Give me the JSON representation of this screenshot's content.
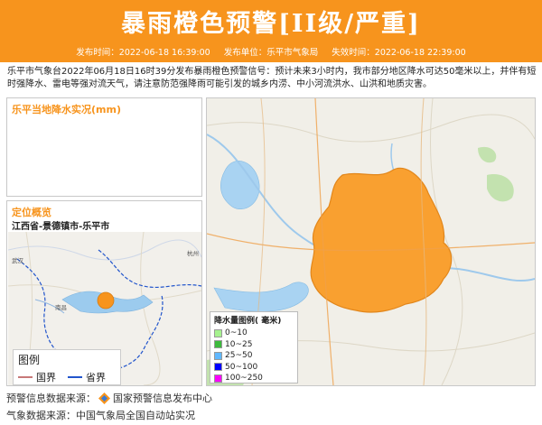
{
  "header": {
    "title": "暴雨橙色预警[II级/严重]",
    "publish_time": "发布时间：2022-06-18 16:39:00",
    "publisher": "发布单位：乐平市气象局",
    "expire_time": "失效时间：2022-06-18 22:39:00",
    "accent": "#f7941d"
  },
  "description": "乐平市气象台2022年06月18日16时39分发布暴雨橙色预警信号：预计未来3小时内，我市部分地区降水可达50毫米以上，并伴有短时强降水、雷电等强对流天气，请注意防范强降雨可能引发的城乡内涝、中小河流洪水、山洪和地质灾害。",
  "rain_panel": {
    "title": "乐平当地降水实况(mm)"
  },
  "location_panel": {
    "title": "定位概览",
    "location": "江西省-景德镇市-乐平市"
  },
  "location_map_labels": {
    "wuhan": "武汉",
    "nanchang": "南昌",
    "hangzhou": "杭州"
  },
  "rain_legend": {
    "title": "降水量图例( 毫米)",
    "items": [
      {
        "label": "0~10",
        "color": "#a6f28f"
      },
      {
        "label": "10~25",
        "color": "#3dba3d"
      },
      {
        "label": "25~50",
        "color": "#61b8ff"
      },
      {
        "label": "50~100",
        "color": "#0000ff"
      },
      {
        "label": "100~250",
        "color": "#fa00fa"
      }
    ]
  },
  "location_legend": {
    "title": "图例",
    "national_border": "国界",
    "provincial_border": "省界",
    "national_color": "#c87878",
    "provincial_color": "#2255cc"
  },
  "footer": {
    "warning_source_label": "预警信息数据来源：",
    "warning_source": "国家预警信息发布中心",
    "weather_source": "气象数据来源：中国气象局全国自动站实况"
  },
  "icons": {
    "source_logo": "warning-center-logo-icon"
  }
}
